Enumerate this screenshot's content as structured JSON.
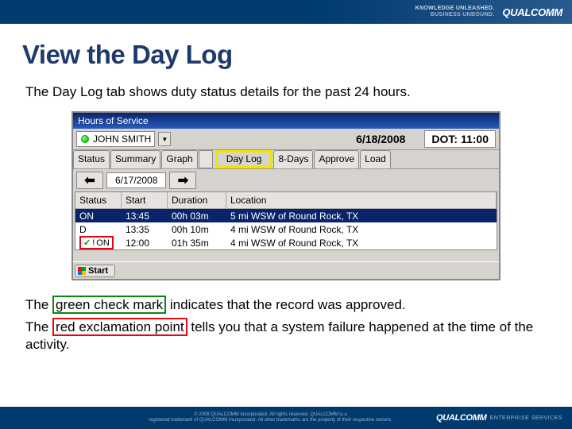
{
  "header": {
    "tagline_line1": "KNOWLEDGE UNLEASHED.",
    "tagline_line2": "BUSINESS UNBOUND.",
    "brand": "QUALCOMM"
  },
  "page": {
    "title": "View the Day Log",
    "lead": "The Day Log tab shows duty status details for the past 24 hours.",
    "note1_pre": "The ",
    "note1_hl": "green check mark",
    "note1_post": " indicates that the record was approved.",
    "note2_pre": "The ",
    "note2_hl": "red exclamation point",
    "note2_post": " tells you that a system failure happened at the time of the activity."
  },
  "app": {
    "window_title": "Hours of Service",
    "driver_name": "JOHN SMITH",
    "top_date": "6/18/2008",
    "dot_label": "DOT: 11:00",
    "tabs": {
      "status": "Status",
      "summary": "Summary",
      "graph": "Graph",
      "day_log": "Day Log",
      "eight_days": "8-Days",
      "approve": "Approve",
      "load": "Load"
    },
    "nav_date": "6/17/2008",
    "columns": {
      "status": "Status",
      "start": "Start",
      "duration": "Duration",
      "location": "Location"
    },
    "rows": [
      {
        "status": "ON",
        "start": "13:45",
        "duration": "00h 03m",
        "location": "5 mi WSW of Round Rock, TX"
      },
      {
        "status": "D",
        "start": "13:35",
        "duration": "00h 10m",
        "location": "4 mi WSW of Round Rock, TX"
      },
      {
        "status": "ON",
        "start": "12:00",
        "duration": "01h 35m",
        "location": "4 mi WSW of Round Rock, TX",
        "approved": true
      }
    ],
    "start_button": "Start"
  },
  "footer": {
    "copyright_line1": "© 2008 QUALCOMM Incorporated. All rights reserved. QUALCOMM is a",
    "copyright_line2": "registered trademark of QUALCOMM Incorporated. All other trademarks are the property of their respective owners.",
    "brand": "QUALCOMM",
    "services": "ENTERPRISE SERVICES"
  }
}
